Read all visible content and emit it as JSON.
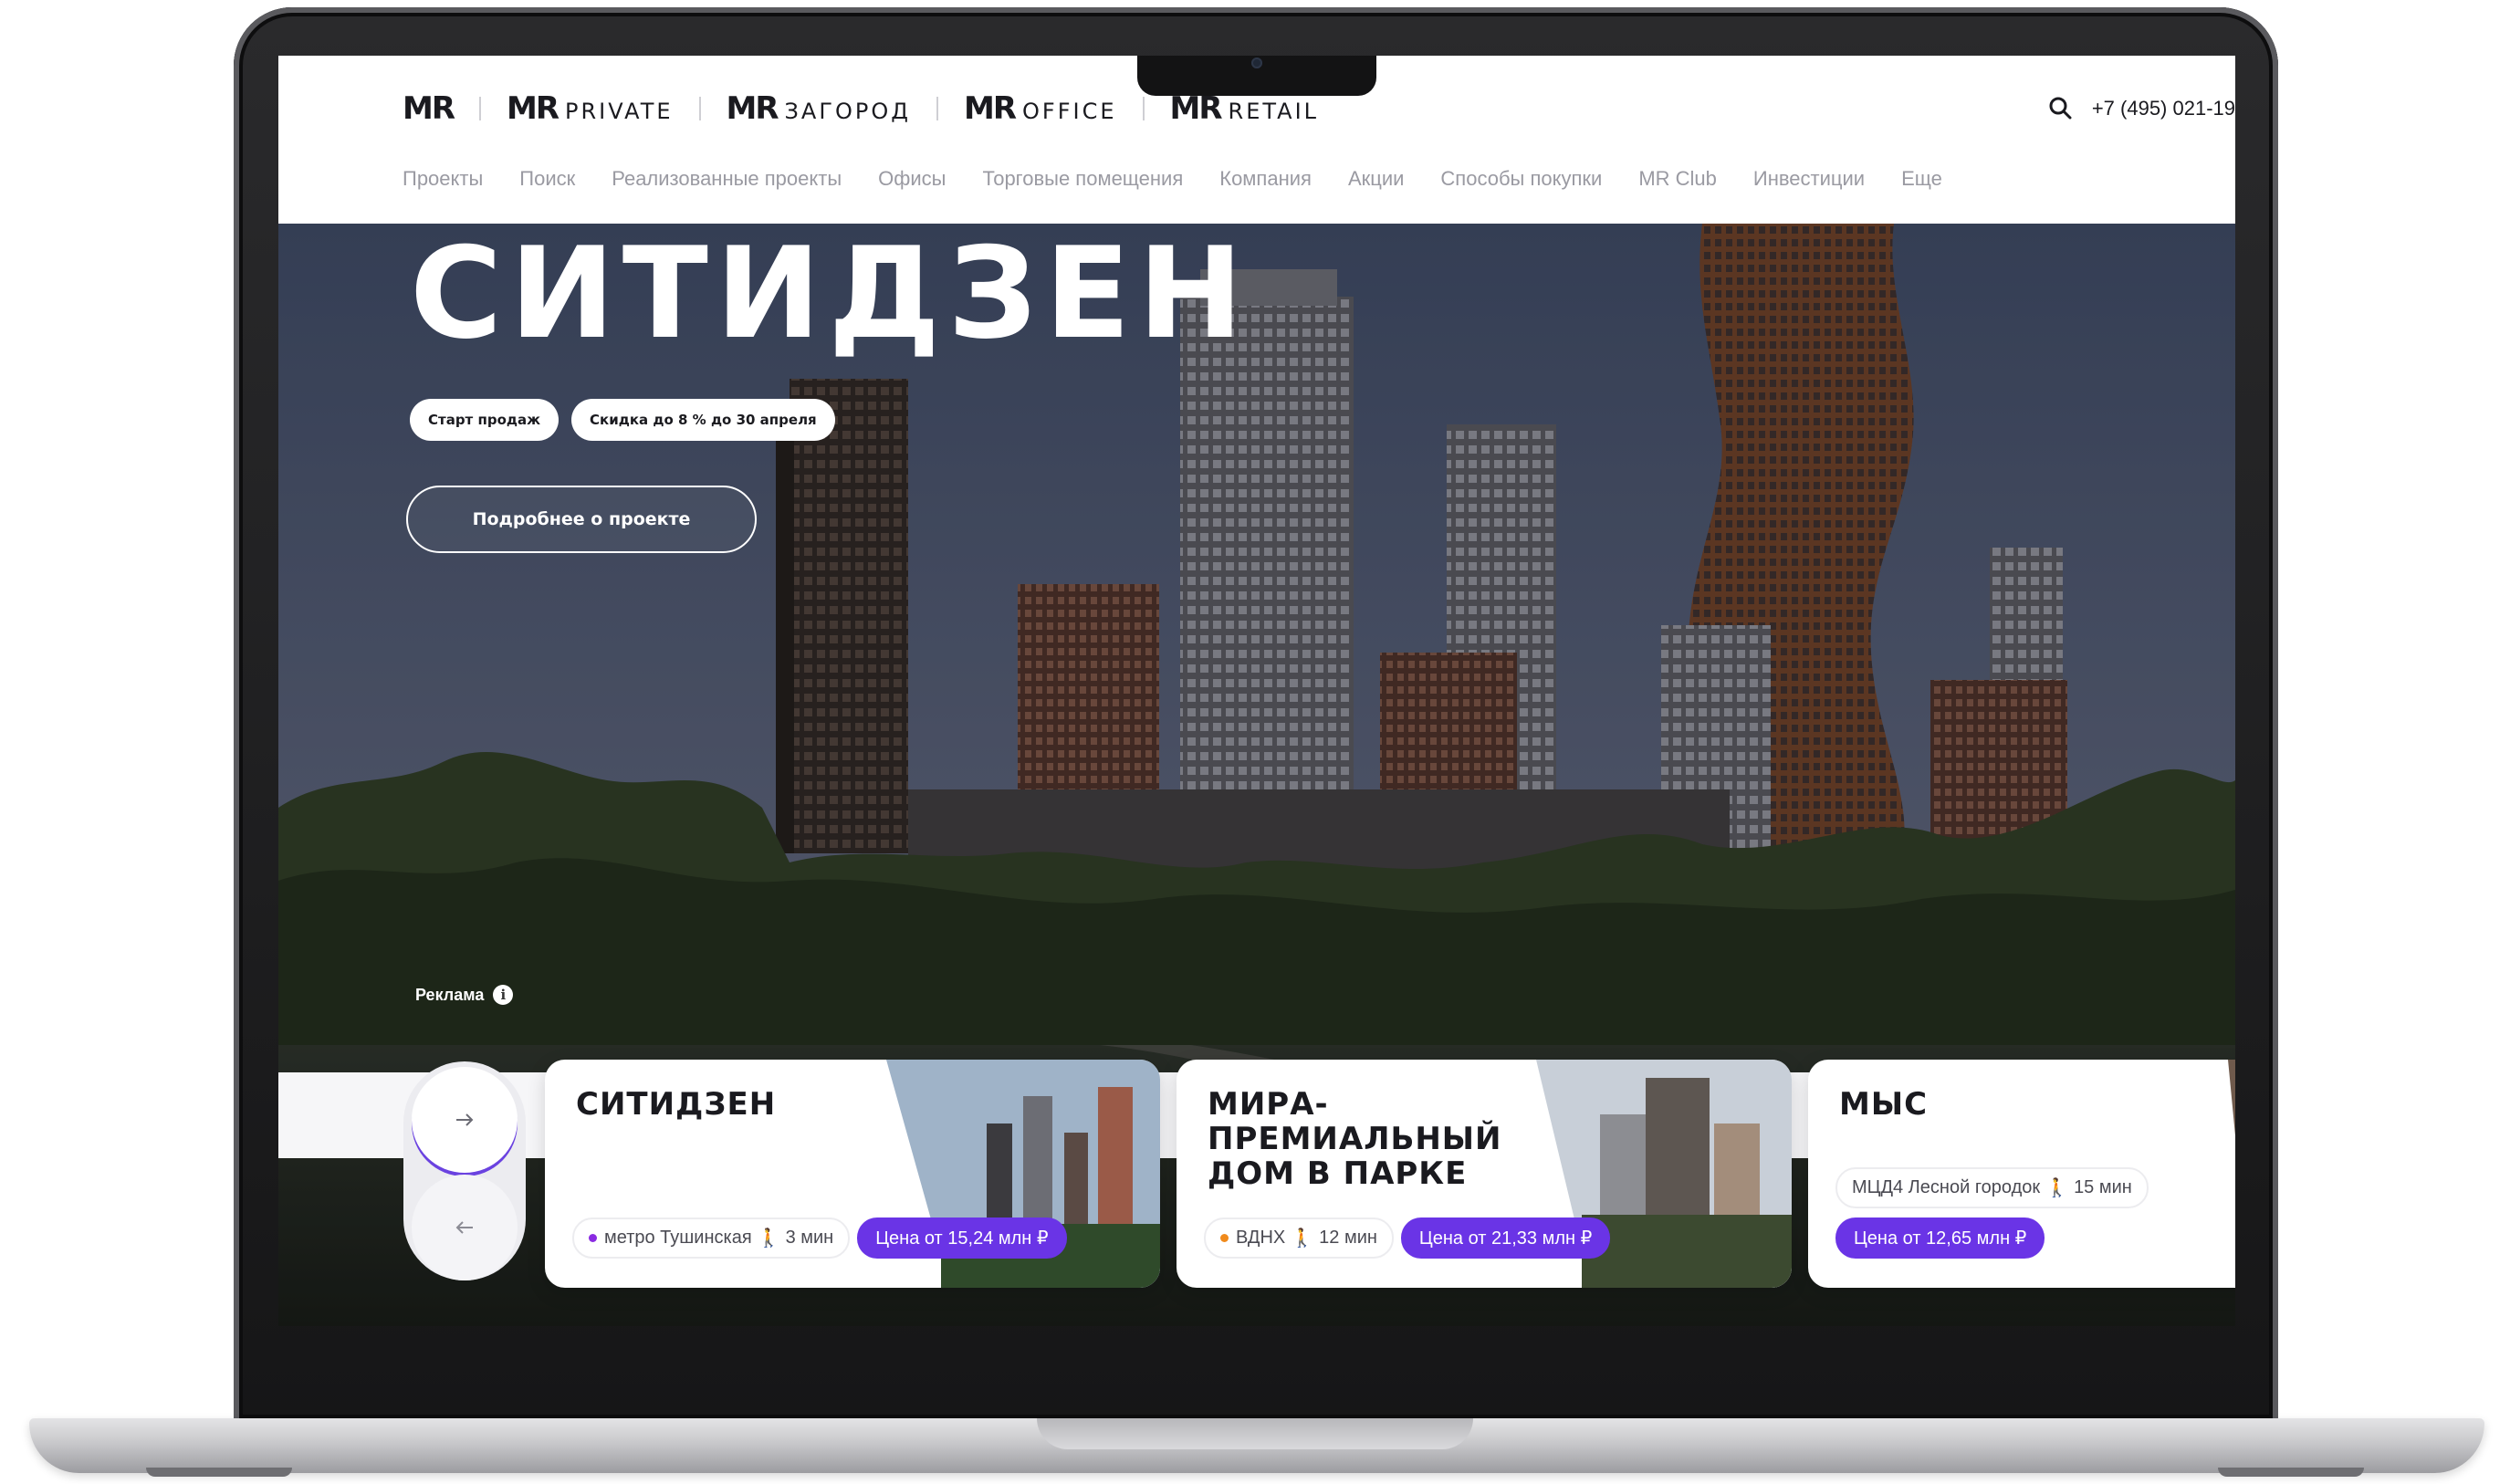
{
  "header": {
    "brands": [
      {
        "mark": "MR",
        "suffix": ""
      },
      {
        "mark": "MR",
        "suffix": "Private"
      },
      {
        "mark": "MR",
        "suffix": "Загород"
      },
      {
        "mark": "MR",
        "suffix": "Office"
      },
      {
        "mark": "MR",
        "suffix": "Retail"
      }
    ],
    "phone": "+7 (495) 021-19",
    "nav": [
      "Проекты",
      "Поиск",
      "Реализованные проекты",
      "Офисы",
      "Торговые помещения",
      "Компания",
      "Акции",
      "Способы покупки",
      "MR Club",
      "Инвестиции",
      "Еще"
    ]
  },
  "hero": {
    "title": "СИТИДЗЕН",
    "badges": [
      "Старт продаж",
      "Скидка до 8 % до 30 апреля"
    ],
    "cta": "Подробнее о проекте",
    "ad_label": "Реклама",
    "info_glyph": "i"
  },
  "slider": {
    "next_glyph": "→",
    "prev_glyph": "←"
  },
  "cards": [
    {
      "name": "СИТИДЗЕН",
      "metro": "метро Тушинская",
      "walk": "3 мин",
      "price": "Цена от 15,24 млн ₽",
      "dot_color": "#8a2be2"
    },
    {
      "name": "МИРА-премиальный дом в парке",
      "metro": "ВДНХ",
      "walk": "12 мин",
      "price": "Цена от 21,33 млн ₽",
      "dot_color": "#f08a1c"
    },
    {
      "name": "МЫС",
      "metro": "МЦД4 Лесной городок",
      "walk": "15 мин",
      "price": "Цена от 12,65 млн ₽",
      "dot_color": ""
    }
  ],
  "colors": {
    "accent": "#6a34e6",
    "hero_sky": "#4a546d",
    "text_dark": "#1a1a1f"
  }
}
